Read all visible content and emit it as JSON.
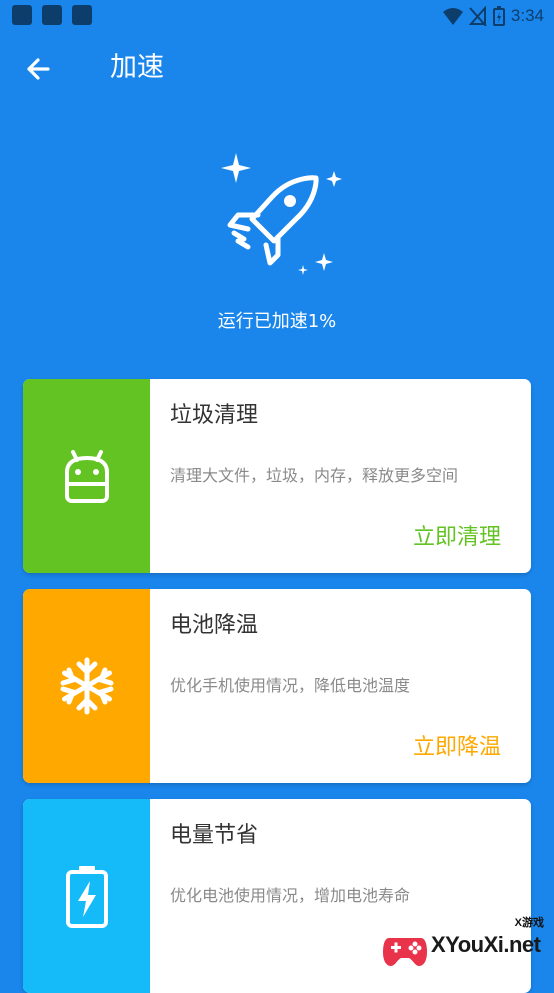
{
  "status_bar": {
    "time": "3:34"
  },
  "header": {
    "title": "加速"
  },
  "hero": {
    "status_text": "运行已加速1%"
  },
  "cards": [
    {
      "title": "垃圾清理",
      "description": "清理大文件，垃圾，内存，释放更多空间",
      "action": "立即清理",
      "color": "#63c323",
      "icon": "android-robot-icon"
    },
    {
      "title": "电池降温",
      "description": "优化手机使用情况，降低电池温度",
      "action": "立即降温",
      "color": "#fea800",
      "icon": "snowflake-icon"
    },
    {
      "title": "电量节省",
      "description": "优化电池使用情况，增加电池寿命",
      "action": "",
      "color": "#14bbf8",
      "icon": "battery-charging-icon"
    }
  ],
  "watermark": {
    "brand": "XYouXi.net",
    "tag": "X游戏"
  }
}
